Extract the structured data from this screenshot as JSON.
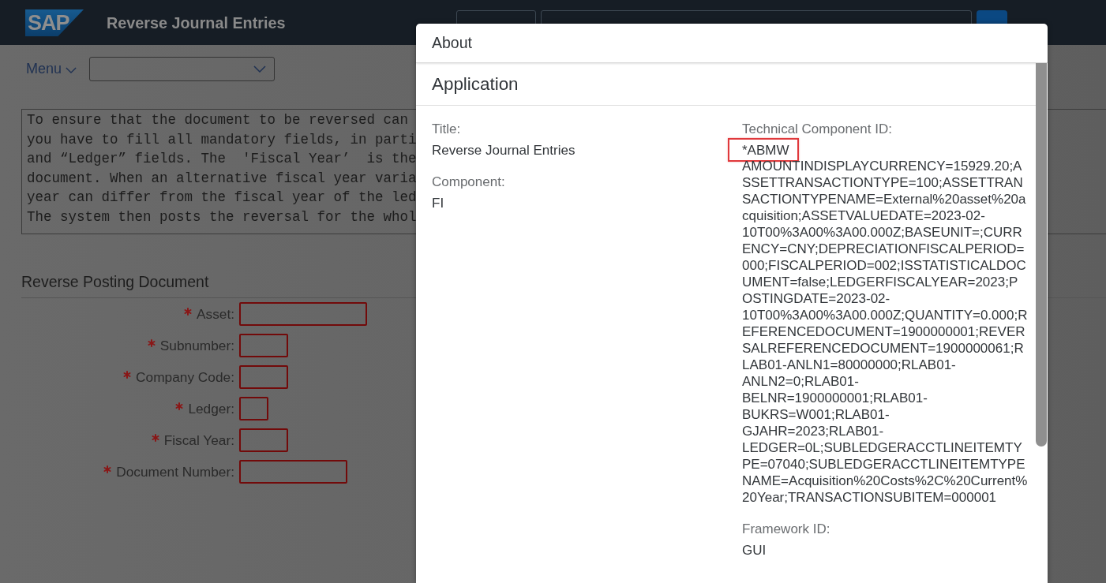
{
  "header": {
    "logo": "SAP",
    "title": "Reverse Journal Entries"
  },
  "toolbar": {
    "menu": "Menu"
  },
  "note": {
    "lines": [
      "To ensure that the document to be reversed can",
      "you have to fill all mandatory fields, in parti",
      "and “Ledger” fields. The  'Fiscal Year’  is the",
      "document. When an alternative fiscal year varia",
      "year can differ from the fiscal year of the led",
      "The system then posts the reversal for the whol"
    ]
  },
  "form": {
    "title": "Reverse Posting Document",
    "fields": [
      {
        "label": "Asset:",
        "required": true,
        "invalid": true
      },
      {
        "label": "Subnumber:",
        "required": true,
        "invalid": true
      },
      {
        "label": "Company Code:",
        "required": true,
        "invalid": true
      },
      {
        "label": "Ledger:",
        "required": true,
        "invalid": true
      },
      {
        "label": "Fiscal Year:",
        "required": true,
        "invalid": true
      },
      {
        "label": "Document Number:",
        "required": true,
        "invalid": true
      }
    ]
  },
  "dialog": {
    "title": "About",
    "section": "Application",
    "columns": [
      [
        {
          "label": "Title:",
          "value": "Reverse Journal Entries"
        },
        {
          "label": "Component:",
          "value": "FI"
        }
      ],
      [
        {
          "label": "Technical Component ID:",
          "code": {
            "text": "*ABMW",
            "highlighted": true
          },
          "value": "AMOUNTINDISPLAYCURRENCY=15929.20;ASSETTRANSACTIONTYPE=100;ASSETTRANSACTIONTYPENAME=External%20asset%20acquisition;ASSETVALUEDATE=2023-02-10T00%3A00%3A00.000Z;BASEUNIT=;CURRENCY=CNY;DEPRECIATIONFISCALPERIOD=000;FISCALPERIOD=002;ISSTATISTICALDOCUMENT=false;LEDGERFISCALYEAR=2023;POSTINGDATE=2023-02-10T00%3A00%3A00.000Z;QUANTITY=0.000;REFERENCEDOCUMENT=1900000001;REVERSALREFERENCEDOCUMENT=1900000061;RLAB01-ANLN1=80000000;RLAB01-ANLN2=0;RLAB01-BELNR=1900000001;RLAB01-BUKRS=W001;RLAB01-GJAHR=2023;RLAB01-LEDGER=0L;SUBLEDGERACCTLINEITEMTYPE=07040;SUBLEDGERACCTLINEITEMTYPENAME=Acquisition%20Costs%2C%20Current%20Year;TRANSACTIONSUBITEM=000001"
        },
        {
          "label": "Framework ID:",
          "value": "GUI"
        }
      ]
    ]
  }
}
